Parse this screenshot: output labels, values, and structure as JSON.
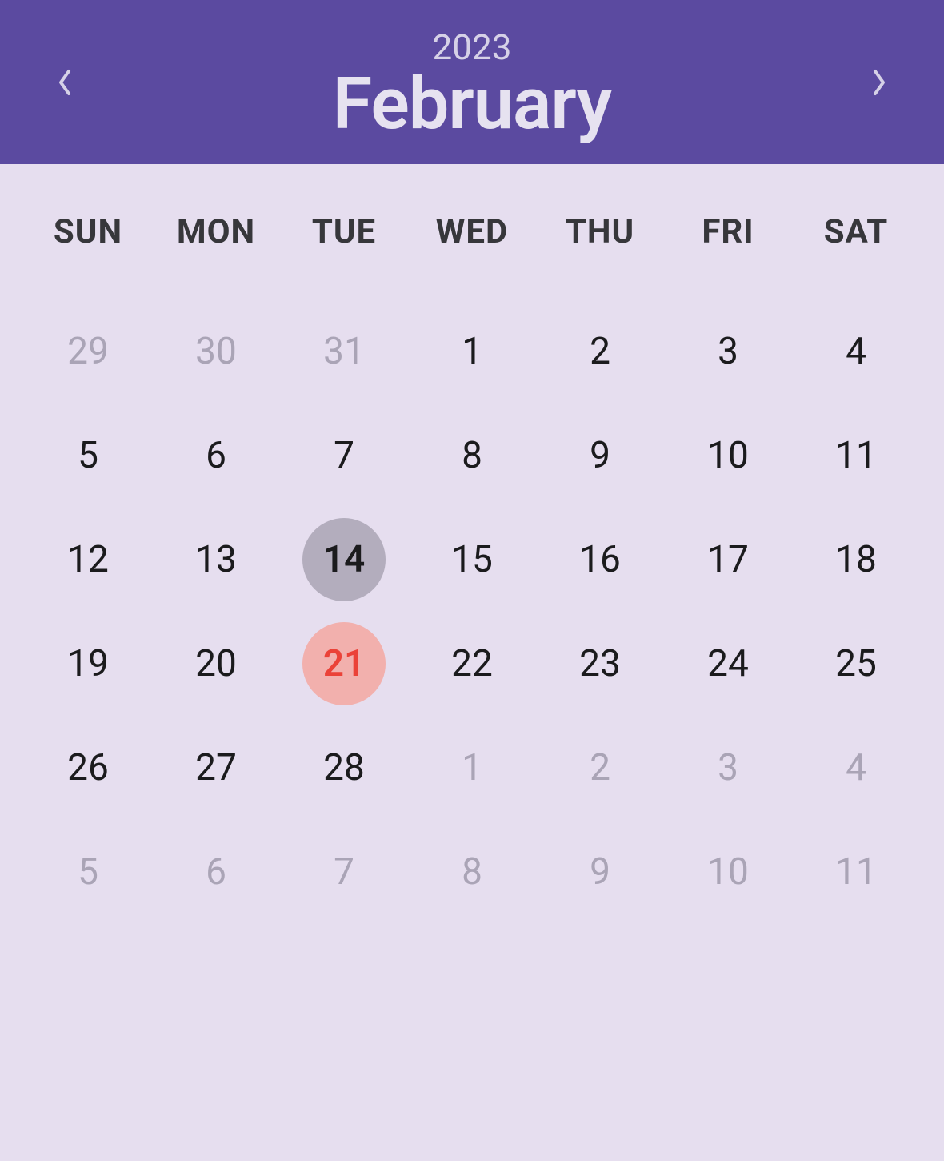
{
  "header": {
    "year": "2023",
    "month": "February"
  },
  "colors": {
    "header_bg": "#5b4aa0",
    "body_bg": "#e6deef",
    "selected_bg": "#b3adbd",
    "highlight_bg": "#f2b0ad",
    "highlight_fg": "#eb4238"
  },
  "day_headers": [
    "SUN",
    "MON",
    "TUE",
    "WED",
    "THU",
    "FRI",
    "SAT"
  ],
  "weeks": [
    [
      {
        "n": "29",
        "outside": true
      },
      {
        "n": "30",
        "outside": true
      },
      {
        "n": "31",
        "outside": true
      },
      {
        "n": "1"
      },
      {
        "n": "2"
      },
      {
        "n": "3"
      },
      {
        "n": "4"
      }
    ],
    [
      {
        "n": "5"
      },
      {
        "n": "6"
      },
      {
        "n": "7"
      },
      {
        "n": "8"
      },
      {
        "n": "9"
      },
      {
        "n": "10"
      },
      {
        "n": "11"
      }
    ],
    [
      {
        "n": "12"
      },
      {
        "n": "13"
      },
      {
        "n": "14",
        "selected": true
      },
      {
        "n": "15"
      },
      {
        "n": "16"
      },
      {
        "n": "17"
      },
      {
        "n": "18"
      }
    ],
    [
      {
        "n": "19"
      },
      {
        "n": "20"
      },
      {
        "n": "21",
        "highlight": true
      },
      {
        "n": "22"
      },
      {
        "n": "23"
      },
      {
        "n": "24"
      },
      {
        "n": "25"
      }
    ],
    [
      {
        "n": "26"
      },
      {
        "n": "27"
      },
      {
        "n": "28"
      },
      {
        "n": "1",
        "outside": true
      },
      {
        "n": "2",
        "outside": true
      },
      {
        "n": "3",
        "outside": true
      },
      {
        "n": "4",
        "outside": true
      }
    ],
    [
      {
        "n": "5",
        "outside": true
      },
      {
        "n": "6",
        "outside": true
      },
      {
        "n": "7",
        "outside": true
      },
      {
        "n": "8",
        "outside": true
      },
      {
        "n": "9",
        "outside": true
      },
      {
        "n": "10",
        "outside": true
      },
      {
        "n": "11",
        "outside": true
      }
    ]
  ]
}
